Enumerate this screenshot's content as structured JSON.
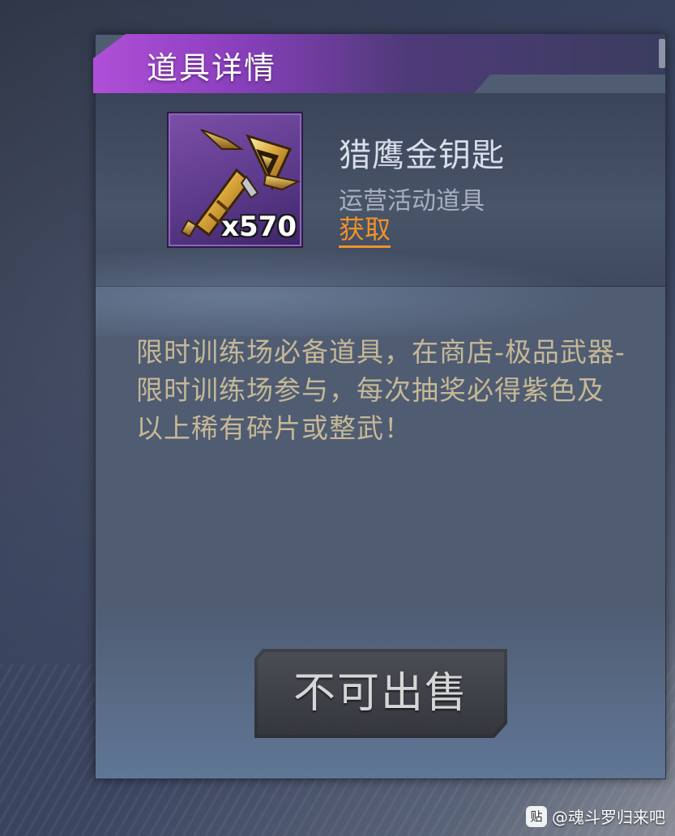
{
  "panel": {
    "title": "道具详情"
  },
  "item": {
    "name": "猎鹰金钥匙",
    "type": "运营活动道具",
    "get_label": "获取",
    "quantity": "x570",
    "icon": "golden-key-icon",
    "rarity_color": "#7b4fa8"
  },
  "description": "限时训练场必备道具，在商店-极品武器-限时训练场参与，每次抽奖必得紫色及以上稀有碎片或整武！",
  "actions": {
    "sell_label": "不可出售"
  },
  "watermark": {
    "icon_glyph": "贴",
    "text": "@魂斗罗归来吧"
  },
  "colors": {
    "title_gradient_start": "#b04fd8",
    "link": "#f0922a",
    "description_text": "#c6b896"
  }
}
